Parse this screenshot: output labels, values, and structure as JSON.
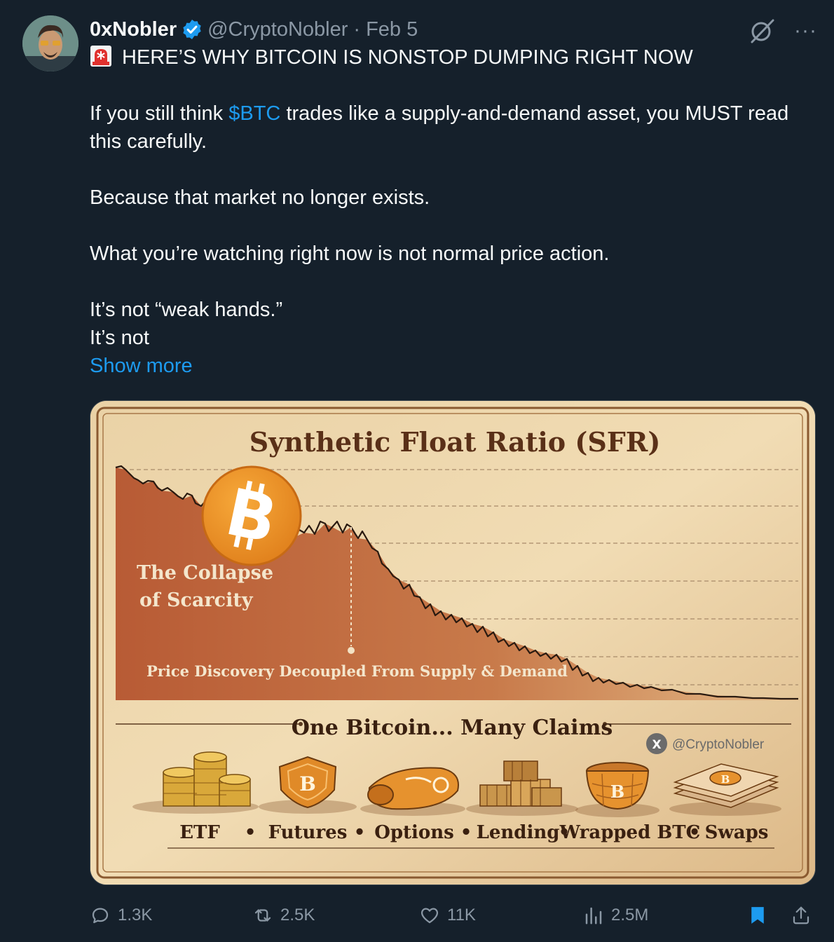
{
  "tweet": {
    "author_name": "0xNobler",
    "handle": "@CryptoNobler",
    "separator": "·",
    "date": "Feb 5",
    "headline": "HERE’S WHY BITCOIN IS NONSTOP DUMPING RIGHT NOW",
    "p1_before": "If you still think ",
    "cashtag": "$BTC",
    "p1_after": " trades like a supply-and-demand asset, you MUST read this carefully.",
    "p2": "Because that market no longer exists.",
    "p3": "What you’re watching right now is not normal price action.",
    "p4_line1": "It’s not “weak hands.”",
    "p4_line2": "It’s not",
    "show_more": "Show more"
  },
  "image": {
    "title": "Synthetic Float Ratio (SFR)",
    "collapse_line1": "The Collapse",
    "collapse_line2": "of Scarcity",
    "price_discovery": "Price Discovery Decoupled From Supply & Demand",
    "claims_title": "One Bitcoin... Many Claims",
    "watermark": "@CryptoNobler",
    "watermark_x": "X",
    "btc_symbol": "B",
    "labels": [
      "ETF",
      "Futures",
      "Options",
      "Lending",
      "Wrapped BTC",
      "Swaps"
    ],
    "bullet": "•"
  },
  "actions": {
    "replies": "1.3K",
    "reposts": "2.5K",
    "likes": "11K",
    "views": "2.5M"
  },
  "colors": {
    "background": "#15202b",
    "accent": "#1d9bf0",
    "muted": "#8b98a5"
  },
  "icons": [
    "verified-badge-icon",
    "grok-icon",
    "more-icon",
    "siren-icon",
    "reply-icon",
    "repost-icon",
    "like-icon",
    "views-icon",
    "bookmark-icon",
    "share-icon"
  ]
}
